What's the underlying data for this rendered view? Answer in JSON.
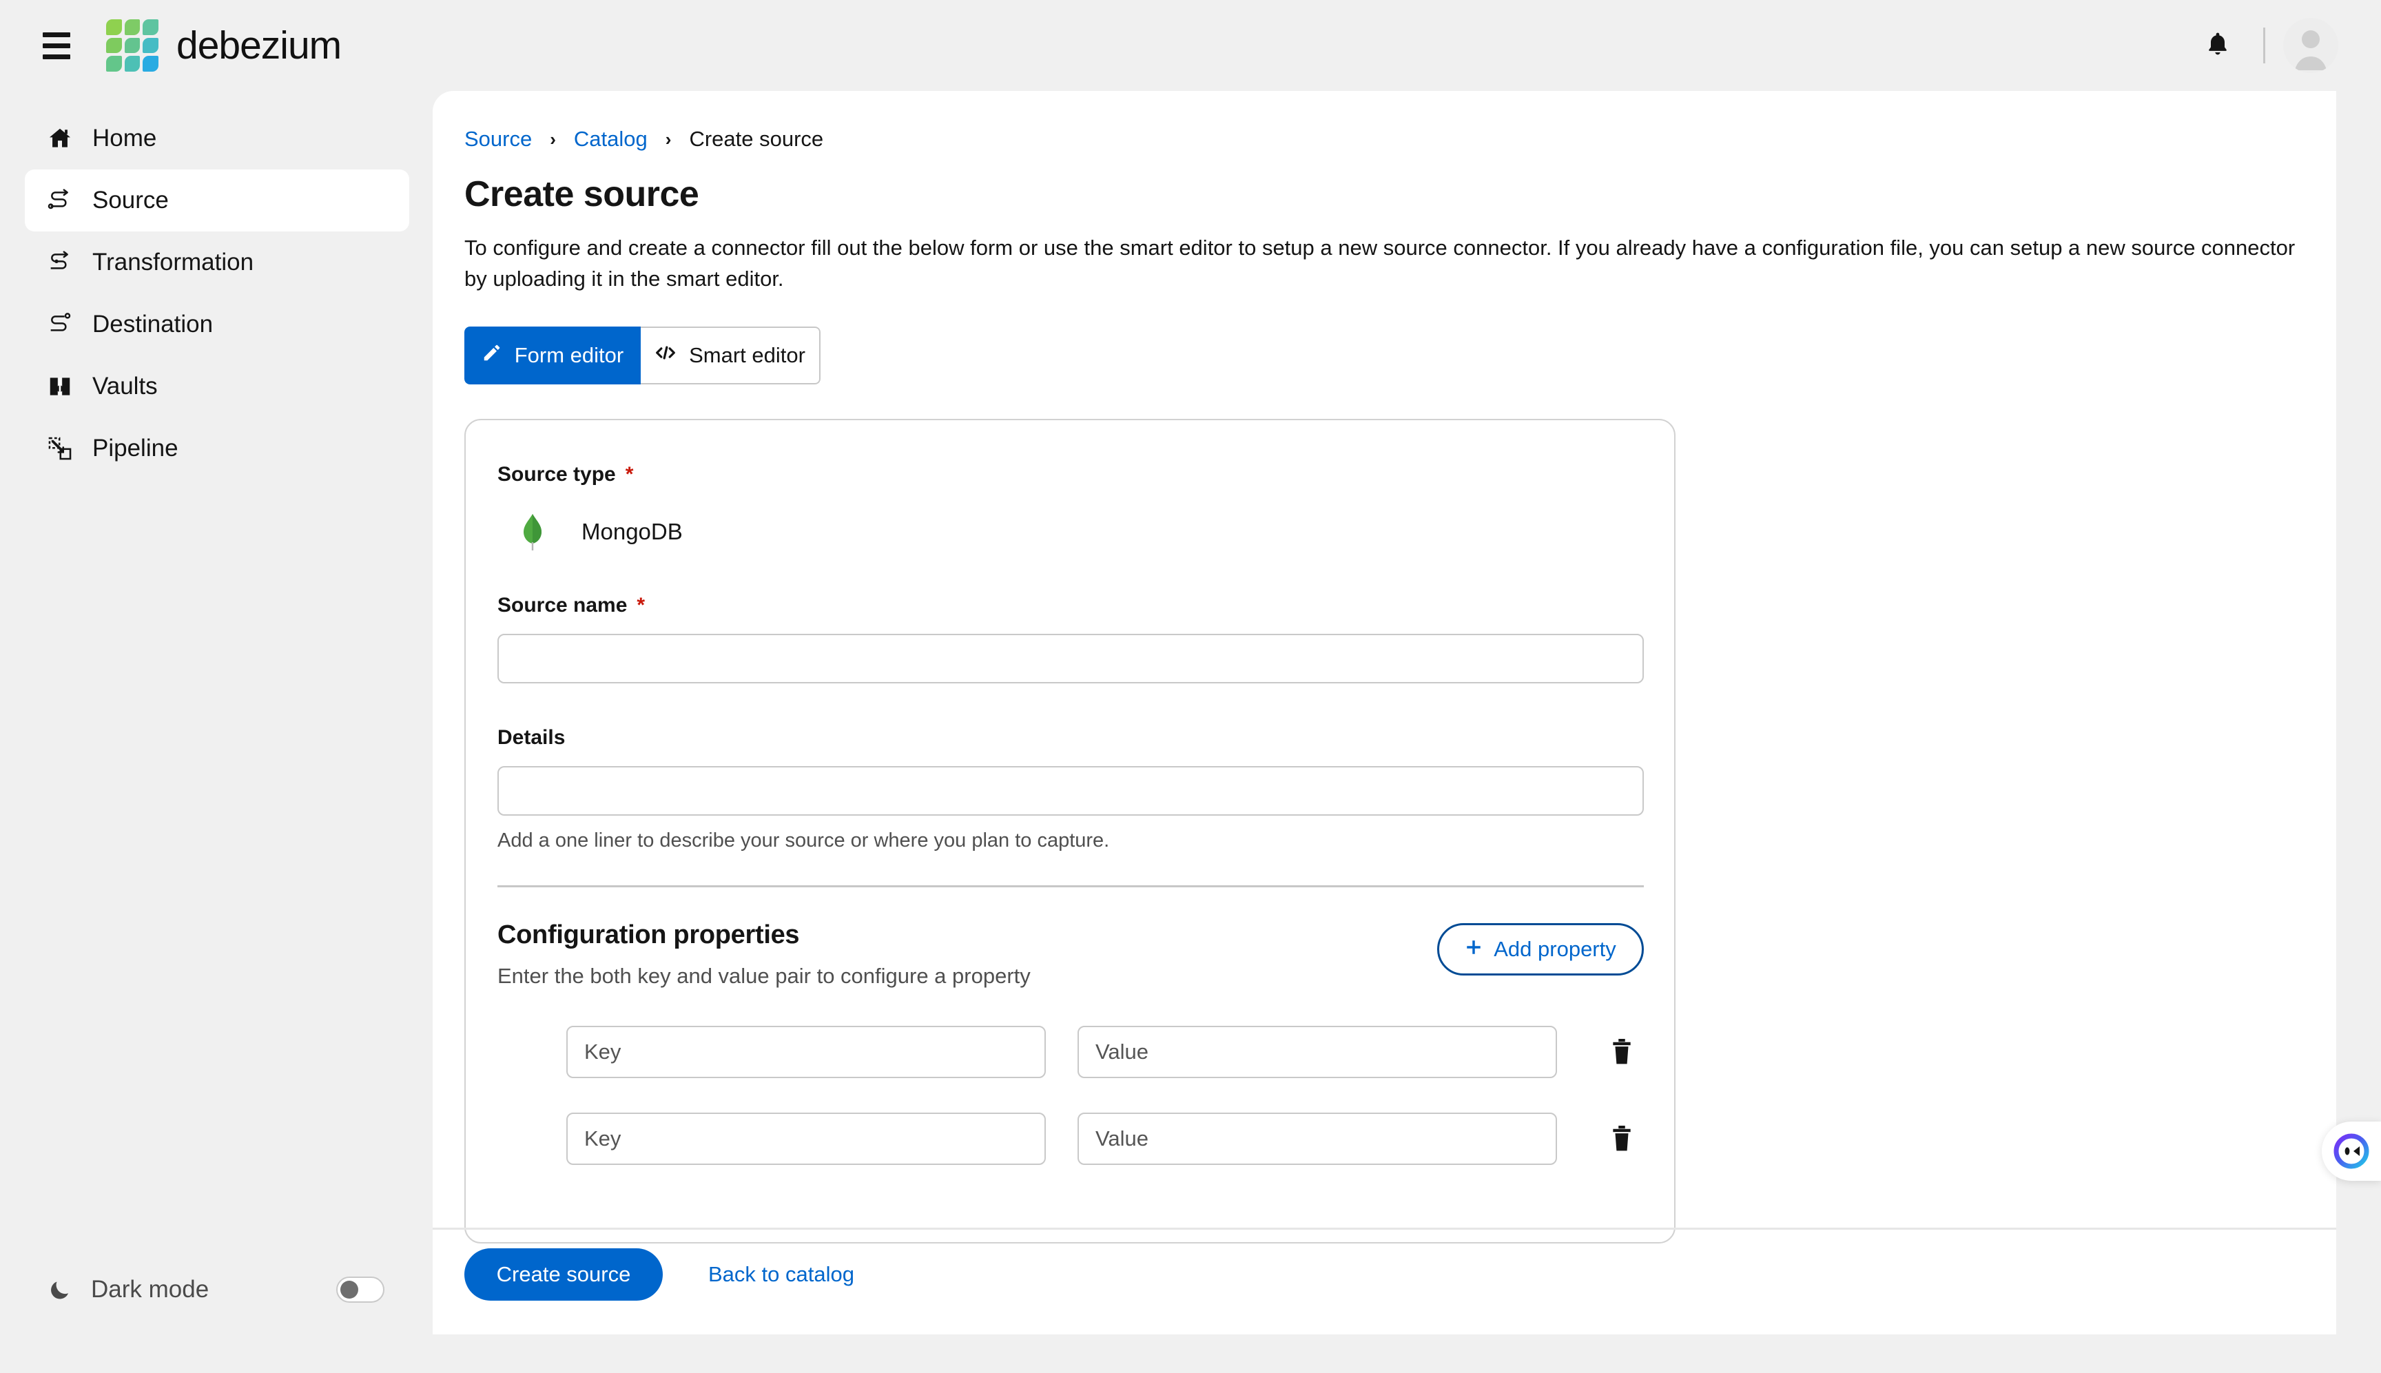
{
  "header": {
    "menu_icon": "hamburger-icon",
    "brand_name": "debezium",
    "notifications_icon": "bell-icon",
    "avatar_icon": "user-avatar-icon"
  },
  "colors": {
    "accent_blue": "#0066cc",
    "accent_blue_dark": "#004b95",
    "required_red": "#c9190b",
    "page_bg": "#f0f0f0",
    "panel_bg": "#ffffff",
    "border_gray": "#c9c9c9",
    "mongo_green": "#4faa41"
  },
  "sidebar": {
    "items": [
      {
        "label": "Home",
        "icon": "home-icon",
        "active": false
      },
      {
        "label": "Source",
        "icon": "source-flow-icon",
        "active": true
      },
      {
        "label": "Transformation",
        "icon": "transformation-flow-icon",
        "active": false
      },
      {
        "label": "Destination",
        "icon": "destination-flow-icon",
        "active": false
      },
      {
        "label": "Vaults",
        "icon": "vault-book-icon",
        "active": false
      },
      {
        "label": "Pipeline",
        "icon": "pipeline-icon",
        "active": false
      }
    ],
    "dark_mode": {
      "label": "Dark mode",
      "icon": "moon-icon",
      "enabled": false
    }
  },
  "breadcrumb": {
    "items": [
      {
        "label": "Source",
        "link": true
      },
      {
        "label": "Catalog",
        "link": true
      },
      {
        "label": "Create source",
        "link": false
      }
    ],
    "separator": "›"
  },
  "page": {
    "title": "Create source",
    "description": "To configure and create a connector fill out the below form or use the smart editor to setup a new source connector. If you already have a configuration file, you can setup a new source connector by uploading it in the smart editor."
  },
  "editor_toggle": {
    "options": [
      {
        "label": "Form editor",
        "icon": "pencil-icon",
        "active": true
      },
      {
        "label": "Smart editor",
        "icon": "code-icon",
        "active": false
      }
    ]
  },
  "form": {
    "source_type": {
      "label": "Source type",
      "required_marker": "*",
      "value": "MongoDB",
      "icon": "mongodb-leaf-icon"
    },
    "source_name": {
      "label": "Source name",
      "required_marker": "*",
      "value": "",
      "placeholder": ""
    },
    "details": {
      "label": "Details",
      "value": "",
      "placeholder": "",
      "helper": "Add a one liner to describe your source or where you plan to capture."
    },
    "config": {
      "title": "Configuration properties",
      "subtitle": "Enter the both key and value pair to configure a property",
      "add_button": {
        "label": "Add property",
        "icon": "plus-icon"
      },
      "rows": [
        {
          "key_placeholder": "Key",
          "key_value": "",
          "value_placeholder": "Value",
          "value_value": "",
          "delete_icon": "trash-icon"
        },
        {
          "key_placeholder": "Key",
          "key_value": "",
          "value_placeholder": "Value",
          "value_value": "",
          "delete_icon": "trash-icon"
        }
      ]
    }
  },
  "footer": {
    "primary_label": "Create source",
    "secondary_label": "Back to catalog"
  },
  "chat_widget": {
    "icon": "chat-assistant-icon"
  }
}
